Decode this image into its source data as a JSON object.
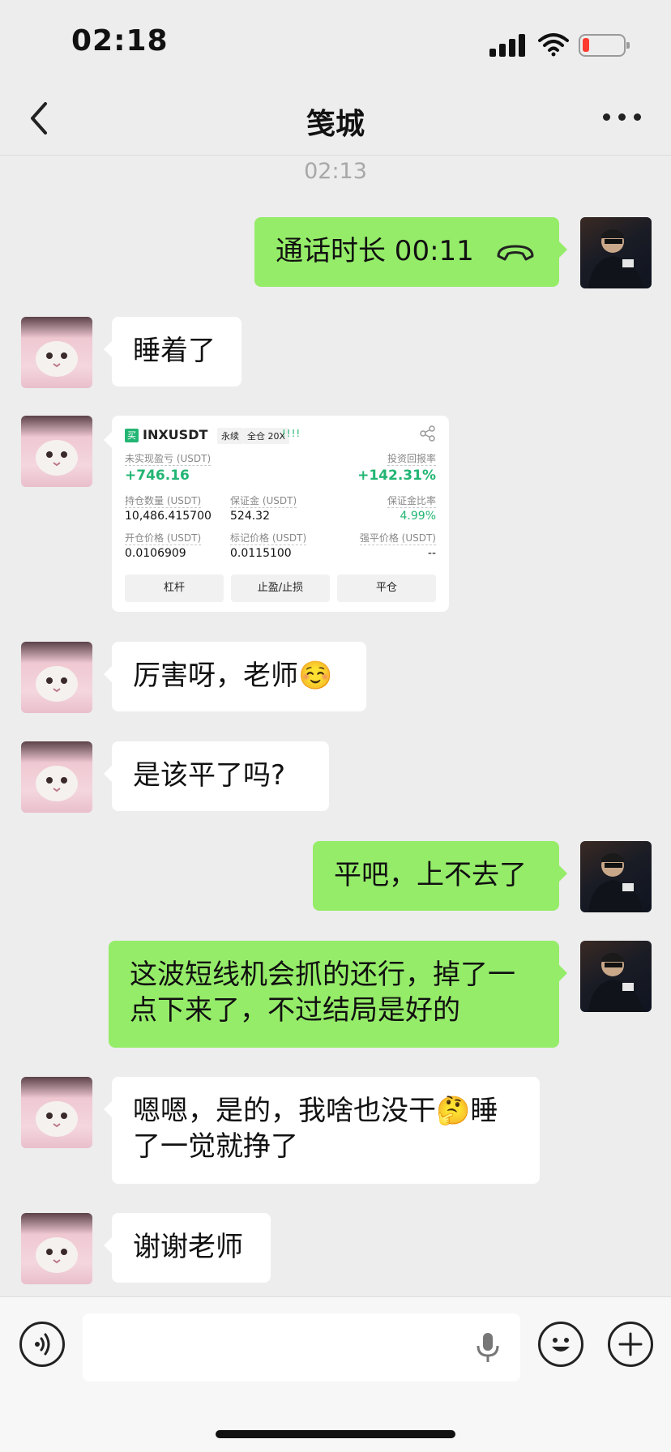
{
  "status_bar": {
    "time": "02:18"
  },
  "header": {
    "title": "笺城"
  },
  "timestamp": "02:13",
  "messages": {
    "call": {
      "label": "通话时长 00:11"
    },
    "m1": "睡着了",
    "m3": "厉害呀，老师☺️",
    "m4": "是该平了吗?",
    "m5": "平吧，上不去了",
    "m6": "这波短线机会抓的还行，掉了一点下来了，不过结局是好的",
    "m7": "嗯嗯，是的，我啥也没干🤔睡了一觉就挣了",
    "m8": "谢谢老师"
  },
  "trade_card": {
    "side": "买",
    "symbol": "INXUSDT",
    "tag_perpetual": "永续",
    "tag_margin": "全仓 20X",
    "signal": "!!!!",
    "pnl_label": "未实现盈亏 (USDT)",
    "pnl_value": "+746.16",
    "roe_label": "投资回报率",
    "roe_value": "+142.31%",
    "size_label": "持仓数量 (USDT)",
    "size_value": "10,486.415700",
    "margin_label": "保证金 (USDT)",
    "margin_value": "524.32",
    "margin_ratio_label": "保证金比率",
    "margin_ratio_value": "4.99%",
    "entry_label": "开仓价格 (USDT)",
    "entry_value": "0.0106909",
    "mark_label": "标记价格 (USDT)",
    "mark_value": "0.0115100",
    "liq_label": "强平价格 (USDT)",
    "liq_value": "--",
    "btn_leverage": "杠杆",
    "btn_tpsl": "止盈/止损",
    "btn_close": "平仓"
  },
  "colors": {
    "outgoing_bubble": "#95ec69",
    "incoming_bubble": "#ffffff",
    "background": "#ededed",
    "profit_green": "#22b573"
  },
  "icons": [
    "back-icon",
    "more-icon",
    "hangup-icon",
    "share-icon",
    "voice-icon",
    "mic-icon",
    "emoji-icon",
    "plus-icon"
  ]
}
